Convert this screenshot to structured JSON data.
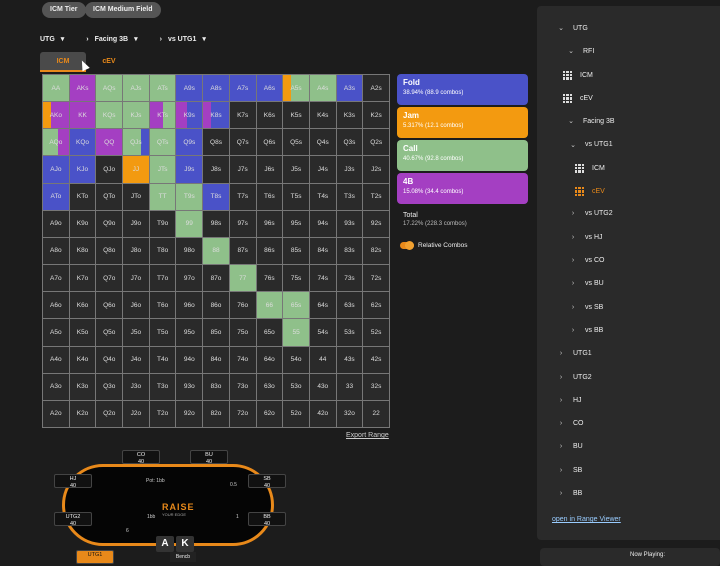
{
  "chips": [
    "ICM Tier",
    "ICM Medium Field"
  ],
  "filters": [
    "UTG",
    "Facing 3B",
    "vs UTG1"
  ],
  "tabs": [
    "ICM",
    "cEV"
  ],
  "colors": {
    "fold": "#4a52c8",
    "jam": "#f39a10",
    "call": "#8fc08a",
    "bet4": "#a43fc2",
    "empty": "#2a2a2a"
  },
  "grid": {
    "rows": [
      [
        "AA",
        "AKs",
        "AQs",
        "AJs",
        "ATs",
        "A9s",
        "A8s",
        "A7s",
        "A6s",
        "A5s",
        "A4s",
        "A3s",
        "A2s"
      ],
      [
        "AKo",
        "KK",
        "KQs",
        "KJs",
        "KTs",
        "K9s",
        "K8s",
        "K7s",
        "K6s",
        "K5s",
        "K4s",
        "K3s",
        "K2s"
      ],
      [
        "AQo",
        "KQo",
        "QQ",
        "QJs",
        "QTs",
        "Q9s",
        "Q8s",
        "Q7s",
        "Q6s",
        "Q5s",
        "Q4s",
        "Q3s",
        "Q2s"
      ],
      [
        "AJo",
        "KJo",
        "QJo",
        "JJ",
        "JTs",
        "J9s",
        "J8s",
        "J7s",
        "J6s",
        "J5s",
        "J4s",
        "J3s",
        "J2s"
      ],
      [
        "ATo",
        "KTo",
        "QTo",
        "JTo",
        "TT",
        "T9s",
        "T8s",
        "T7s",
        "T6s",
        "T5s",
        "T4s",
        "T3s",
        "T2s"
      ],
      [
        "A9o",
        "K9o",
        "Q9o",
        "J9o",
        "T9o",
        "99",
        "98s",
        "97s",
        "96s",
        "95s",
        "94s",
        "93s",
        "92s"
      ],
      [
        "A8o",
        "K8o",
        "Q8o",
        "J8o",
        "T8o",
        "98o",
        "88",
        "87s",
        "86s",
        "85s",
        "84s",
        "83s",
        "82s"
      ],
      [
        "A7o",
        "K7o",
        "Q7o",
        "J7o",
        "T7o",
        "97o",
        "87o",
        "77",
        "76s",
        "75s",
        "74s",
        "73s",
        "72s"
      ],
      [
        "A6o",
        "K6o",
        "Q6o",
        "J6o",
        "T6o",
        "96o",
        "86o",
        "76o",
        "66",
        "65s",
        "64s",
        "63s",
        "62s"
      ],
      [
        "A5o",
        "K5o",
        "Q5o",
        "J5o",
        "T5o",
        "95o",
        "85o",
        "75o",
        "65o",
        "55",
        "54s",
        "53s",
        "52s"
      ],
      [
        "A4o",
        "K4o",
        "Q4o",
        "J4o",
        "T4o",
        "94o",
        "84o",
        "74o",
        "64o",
        "54o",
        "44",
        "43s",
        "42s"
      ],
      [
        "A3o",
        "K3o",
        "Q3o",
        "J3o",
        "T3o",
        "93o",
        "83o",
        "73o",
        "63o",
        "53o",
        "43o",
        "33",
        "32s"
      ],
      [
        "A2o",
        "K2o",
        "Q2o",
        "J2o",
        "T2o",
        "92o",
        "82o",
        "72o",
        "62o",
        "52o",
        "42o",
        "32o",
        "22"
      ]
    ],
    "mix": {
      "0-0": [
        [
          "call",
          1
        ]
      ],
      "0-1": [
        [
          "bet4",
          1
        ]
      ],
      "0-2": [
        [
          "call",
          1
        ]
      ],
      "0-3": [
        [
          "call",
          1
        ]
      ],
      "0-4": [
        [
          "call",
          1
        ]
      ],
      "0-5": [
        [
          "fold",
          1
        ]
      ],
      "0-6": [
        [
          "fold",
          1
        ]
      ],
      "0-7": [
        [
          "fold",
          1
        ]
      ],
      "0-8": [
        [
          "fold",
          1
        ]
      ],
      "0-9": [
        [
          "jam",
          0.3
        ],
        [
          "call",
          0.7
        ]
      ],
      "0-10": [
        [
          "call",
          1
        ]
      ],
      "0-11": [
        [
          "fold",
          1
        ]
      ],
      "1-0": [
        [
          "jam",
          0.3
        ],
        [
          "bet4",
          0.7
        ]
      ],
      "1-1": [
        [
          "bet4",
          1
        ]
      ],
      "1-2": [
        [
          "call",
          1
        ]
      ],
      "1-3": [
        [
          "call",
          1
        ]
      ],
      "1-4": [
        [
          "bet4",
          0.5
        ],
        [
          "call",
          0.5
        ]
      ],
      "1-5": [
        [
          "bet4",
          0.4
        ],
        [
          "fold",
          0.6
        ]
      ],
      "1-6": [
        [
          "bet4",
          0.3
        ],
        [
          "fold",
          0.7
        ]
      ],
      "2-0": [
        [
          "call",
          0.6
        ],
        [
          "bet4",
          0.4
        ]
      ],
      "2-1": [
        [
          "fold",
          1
        ]
      ],
      "2-2": [
        [
          "bet4",
          1
        ]
      ],
      "2-3": [
        [
          "call",
          0.7
        ],
        [
          "fold",
          0.3
        ]
      ],
      "2-4": [
        [
          "call",
          1
        ]
      ],
      "2-5": [
        [
          "fold",
          1
        ]
      ],
      "3-0": [
        [
          "fold",
          1
        ]
      ],
      "3-1": [
        [
          "fold",
          1
        ]
      ],
      "3-3": [
        [
          "jam",
          1
        ]
      ],
      "3-4": [
        [
          "call",
          1
        ]
      ],
      "3-5": [
        [
          "fold",
          1
        ]
      ],
      "4-0": [
        [
          "fold",
          1
        ]
      ],
      "4-4": [
        [
          "call",
          1
        ]
      ],
      "4-5": [
        [
          "call",
          1
        ]
      ],
      "4-6": [
        [
          "fold",
          1
        ]
      ],
      "5-5": [
        [
          "call",
          1
        ]
      ],
      "6-6": [
        [
          "call",
          1
        ]
      ],
      "7-7": [
        [
          "call",
          1
        ]
      ],
      "8-8": [
        [
          "call",
          1
        ]
      ],
      "8-9": [
        [
          "call",
          1
        ]
      ],
      "9-9": [
        [
          "call",
          1
        ]
      ]
    }
  },
  "export_label": "Export Range",
  "actions": [
    {
      "key": "fold",
      "name": "Fold",
      "detail": "38.94% (88.9 combos)"
    },
    {
      "key": "jam",
      "name": "Jam",
      "detail": "5.317% (12.1 combos)"
    },
    {
      "key": "call",
      "name": "Call",
      "detail": "40.67% (92.8 combos)"
    },
    {
      "key": "bet4",
      "name": "4B",
      "detail": "15.08% (34.4 combos)"
    }
  ],
  "total": {
    "label": "Total",
    "detail": "17.22% (228.3 combos)"
  },
  "toggle_label": "Relative Combos",
  "sidebar": [
    {
      "level": 0,
      "chev": "⌄",
      "label": "UTG"
    },
    {
      "level": 1,
      "chev": "⌄",
      "label": "RFI"
    },
    {
      "level": 2,
      "icon": "grid",
      "label": "ICM"
    },
    {
      "level": 2,
      "icon": "grid",
      "label": "cEV"
    },
    {
      "level": 1,
      "chev": "⌄",
      "label": "Facing 3B"
    },
    {
      "level": 2,
      "chev": "⌄",
      "label": "vs UTG1"
    },
    {
      "level": 3,
      "icon": "grid",
      "label": "ICM"
    },
    {
      "level": 3,
      "icon": "grid-orange",
      "label": "cEV"
    },
    {
      "level": 2,
      "chev": "›",
      "label": "vs UTG2"
    },
    {
      "level": 2,
      "chev": "›",
      "label": "vs HJ"
    },
    {
      "level": 2,
      "chev": "›",
      "label": "vs CO"
    },
    {
      "level": 2,
      "chev": "›",
      "label": "vs BU"
    },
    {
      "level": 2,
      "chev": "›",
      "label": "vs SB"
    },
    {
      "level": 2,
      "chev": "›",
      "label": "vs BB"
    },
    {
      "level": 0,
      "chev": "›",
      "label": "UTG1"
    },
    {
      "level": 0,
      "chev": "›",
      "label": "UTG2"
    },
    {
      "level": 0,
      "chev": "›",
      "label": "HJ"
    },
    {
      "level": 0,
      "chev": "›",
      "label": "CO"
    },
    {
      "level": 0,
      "chev": "›",
      "label": "BU"
    },
    {
      "level": 0,
      "chev": "›",
      "label": "SB"
    },
    {
      "level": 0,
      "chev": "›",
      "label": "BB"
    }
  ],
  "open_range_viewer": "open in Range Viewer",
  "now_playing": "Now Playing:",
  "table": {
    "seats": [
      {
        "name": "CO",
        "stack": "40"
      },
      {
        "name": "BU",
        "stack": "40"
      },
      {
        "name": "SB",
        "stack": "40"
      },
      {
        "name": "BB",
        "stack": "40"
      },
      {
        "name": "HJ",
        "stack": "40"
      },
      {
        "name": "UTG2",
        "stack": "40"
      },
      {
        "name": "UTG1",
        "stack": ""
      }
    ],
    "pot": "Pot: 1bb",
    "sb_post": "0.5",
    "bb_post": "1",
    "hero_post": "1bb",
    "utg2_post": "6",
    "logo": "RAISE",
    "logo_sub": "YOUR EDGE",
    "hole_cards": [
      "A",
      "K"
    ],
    "hero_label": "Bencb"
  }
}
